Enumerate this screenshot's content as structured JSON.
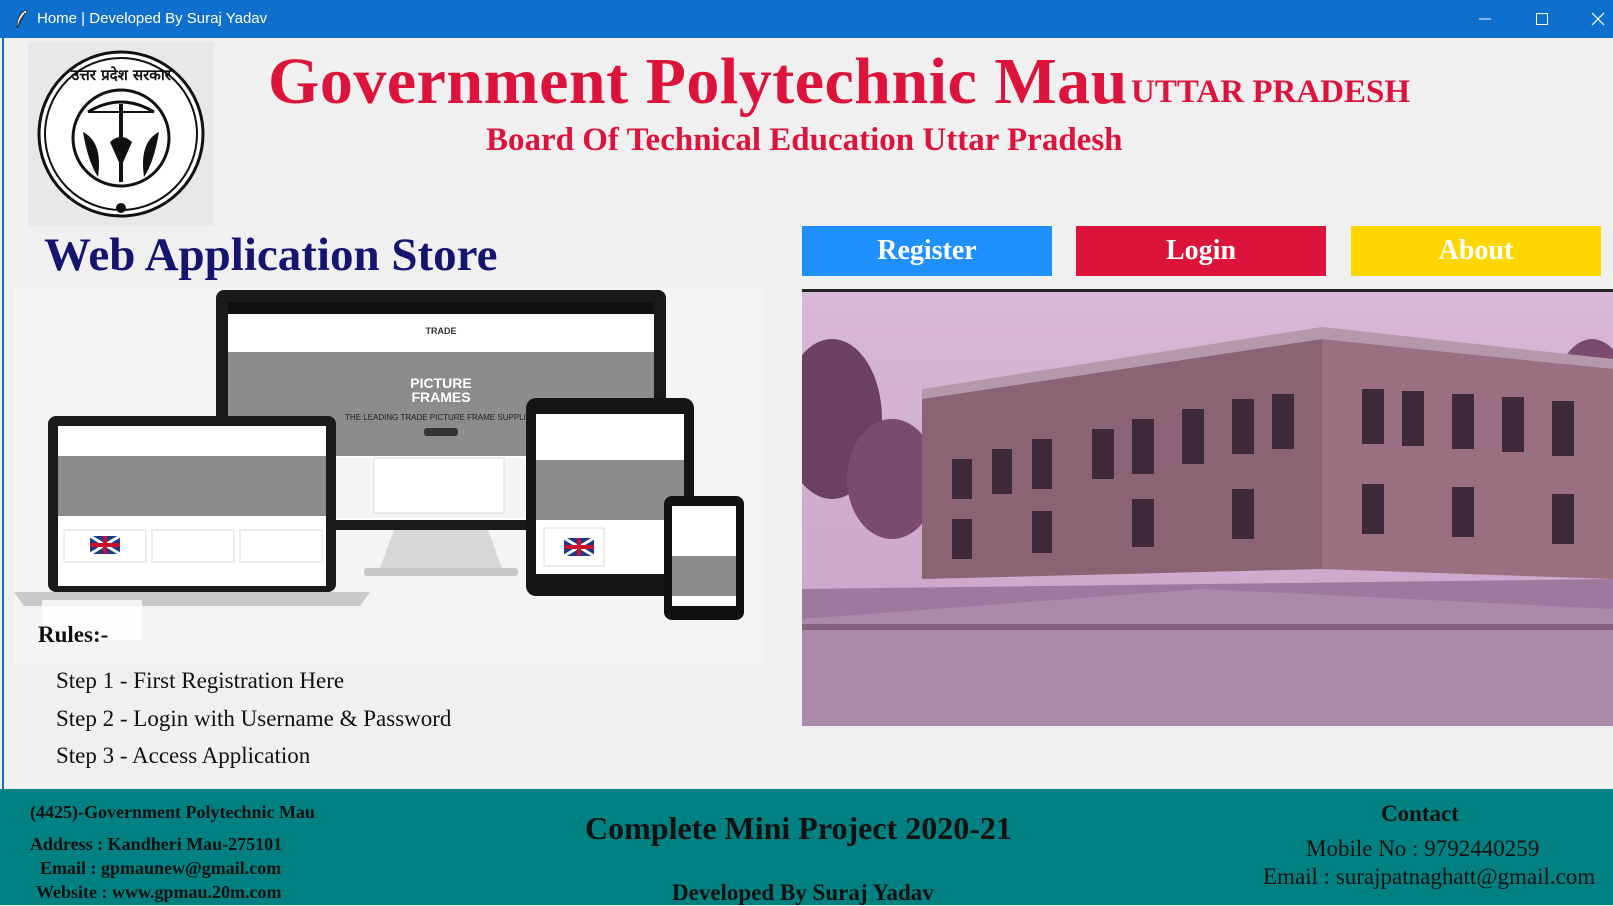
{
  "window": {
    "title": "Home | Developed By Suraj Yadav"
  },
  "header": {
    "title_main": "Government Polytechnic Mau",
    "title_state": "UTTAR PRADESH",
    "subtitle": "Board Of Technical Education Uttar Pradesh",
    "logo_text": "उत्तर प्रदेश सरकार"
  },
  "store_title": "Web Application Store",
  "nav": {
    "register": "Register",
    "login": "Login",
    "about": "About"
  },
  "devices_image": {
    "brand_line1": "TRADE",
    "brand_line2": "PICTURE",
    "brand_line3": "FRAMES",
    "tagline": "THE LEADING TRADE PICTURE FRAME SUPPLIER"
  },
  "rules": {
    "title": "Rules:-",
    "steps": [
      "Step 1 - First Registration Here",
      "Step 2 - Login with Username & Password",
      "Step 3 - Access Application"
    ]
  },
  "footer": {
    "college": "(4425)-Government Polytechnic Mau",
    "address": "Address : Kandheri Mau-275101",
    "email": "Email : gpmaunew@gmail.com",
    "website": "Website : www.gpmau.20m.com",
    "project": "Complete Mini Project 2020-21",
    "developer": "Developed By Suraj Yadav",
    "contact_title": "Contact",
    "mobile": "Mobile No : 9792440259",
    "contact_email": "Email : surajpatnaghatt@gmail.com"
  },
  "colors": {
    "titlebar": "#0f6fcd",
    "heading_red": "#dc143c",
    "store_blue": "#151570",
    "register": "#1e90ff",
    "login": "#dc143c",
    "about": "#ffd700",
    "footer": "#008080"
  }
}
